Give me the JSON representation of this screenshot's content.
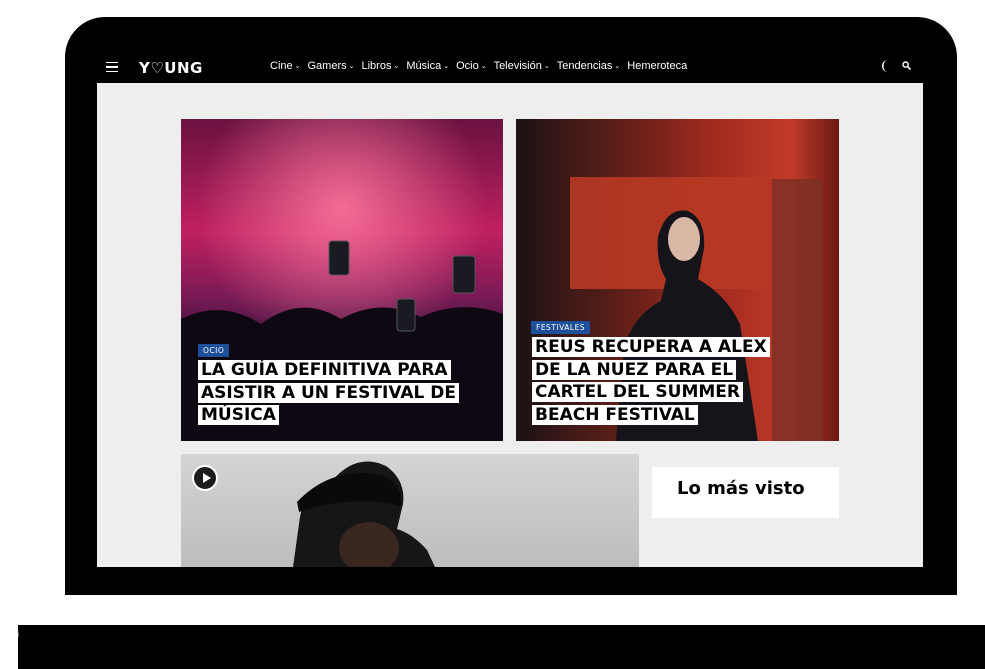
{
  "header": {
    "logo": "Y♡UNG",
    "menu": [
      {
        "label": "Cine",
        "has_dropdown": true
      },
      {
        "label": "Gamers",
        "has_dropdown": true
      },
      {
        "label": "Libros",
        "has_dropdown": true
      },
      {
        "label": "Música",
        "has_dropdown": true
      },
      {
        "label": "Ocio",
        "has_dropdown": true
      },
      {
        "label": "Televisión",
        "has_dropdown": true
      },
      {
        "label": "Tendencias",
        "has_dropdown": true
      },
      {
        "label": "Hemeroteca",
        "has_dropdown": false
      }
    ],
    "dropdown_glyph": "⌄",
    "icons": [
      "menu-icon",
      "moon-icon",
      "search-icon"
    ]
  },
  "featured": [
    {
      "category": "OCIO",
      "title": "LA GUÍA DEFINITIVA PARA ASISTIR A UN FESTIVAL DE MÚSICA"
    },
    {
      "category": "FESTIVALES",
      "title": "REUS RECUPERA A ALEX DE LA NUEZ PARA EL CARTEL DEL SUMMER BEACH FESTIVAL"
    }
  ],
  "video": {
    "icon": "play-icon"
  },
  "sidebar": {
    "most_viewed_title": "Lo más visto"
  },
  "colors": {
    "navbar": "#000000",
    "badge": "#1e4f9a",
    "page_bg": "#eeeeee",
    "laptop_frame": "#000000"
  }
}
